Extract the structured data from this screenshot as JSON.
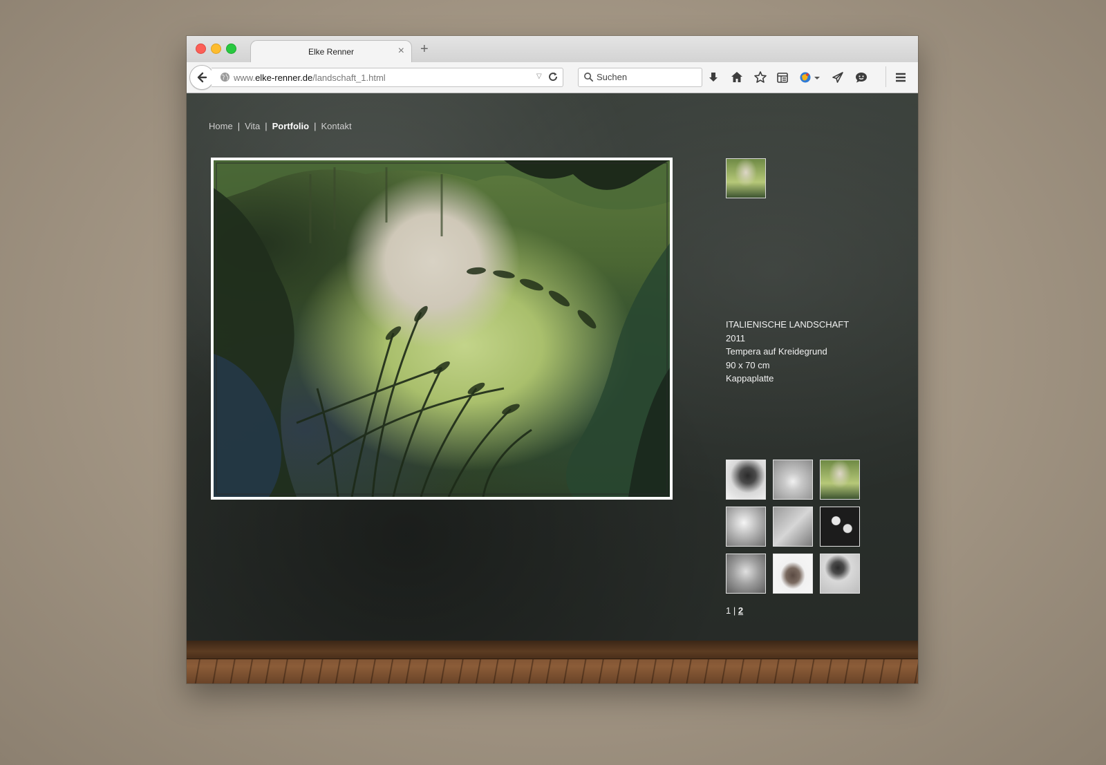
{
  "browser": {
    "tab_title": "Elke Renner",
    "tab_close": "×",
    "new_tab": "+",
    "url_prefix": "www.",
    "url_host": "elke-renner.de",
    "url_path": "/landschaft_1.html",
    "search_placeholder": "Suchen",
    "colors": {
      "red": "#fc5f57",
      "yellow": "#fdbc2e",
      "green": "#28c840"
    },
    "toolbar_icons": [
      "download-icon",
      "home-icon",
      "bookmark-star-icon",
      "reading-list-icon",
      "addon-icon",
      "send-icon",
      "chat-icon",
      "menu-icon"
    ]
  },
  "nav": {
    "items": [
      {
        "label": "Home",
        "active": false
      },
      {
        "label": "Vita",
        "active": false
      },
      {
        "label": "Portfolio",
        "active": true
      },
      {
        "label": "Kontakt",
        "active": false
      }
    ],
    "separator": "|"
  },
  "artwork": {
    "title": "ITALIENISCHE LANDSCHAFT",
    "year": "2011",
    "technique": "Tempera auf Kreidegrund",
    "size": "90 x 70 cm",
    "support": "Kappaplatte"
  },
  "pager": {
    "page1": "1",
    "separator": "|",
    "page2": "2"
  }
}
